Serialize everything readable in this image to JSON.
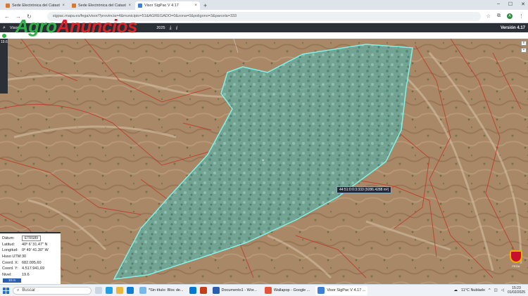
{
  "browser": {
    "tabs": [
      {
        "label": "Sede Electrónica del Catastro",
        "active": false,
        "icon": "catastro-favicon"
      },
      {
        "label": "Sede Electrónica del Catastro",
        "active": false,
        "icon": "catastro-favicon"
      },
      {
        "label": "Visor SigPac V 4.17",
        "active": true,
        "icon": "sigpac-favicon"
      }
    ],
    "newtab": "+",
    "url": "sigpac.mapa.es/fega/visor/?provincia=4&municipio=51&AGREGADO=0&zona=0&poligono=3&parcela=333"
  },
  "watermark": {
    "part1": "Agro",
    "part2": "Anuncios"
  },
  "app": {
    "left_label": "Visor",
    "date_label": "2025",
    "version": "Versión 4.17",
    "scale_label": "19.6"
  },
  "map": {
    "parcel_label": "44:51:0:0:3:333 (9286.4288 m²)"
  },
  "coord_panel": {
    "rows": [
      {
        "key": "Dátum:",
        "value": "ETRS89"
      },
      {
        "key": "Latitud:",
        "value": "40º 6' 31.47\" N"
      },
      {
        "key": "Longitud:",
        "value": "0º 49' 41.30\" W"
      },
      {
        "key": "Huso UTM:",
        "value": "30"
      },
      {
        "key": "Coord. X:",
        "value": "682.095,60"
      },
      {
        "key": "Coord. Y:",
        "value": "4.517.941,69"
      },
      {
        "key": "Nivel:",
        "value": "19.6"
      }
    ],
    "button_label": "10 m"
  },
  "seal": {
    "label": "FEGA"
  },
  "taskbar": {
    "search_placeholder": "Buscar",
    "apps": [
      {
        "label": "*Sin título: Bloc de...",
        "active": false
      },
      {
        "label": "Documento1 - Wor...",
        "active": false
      },
      {
        "label": "Wallapop - Google ...",
        "active": false
      },
      {
        "label": "Visor SigPac V 4.17 ...",
        "active": true
      }
    ],
    "weather": "11°C  Nublado",
    "time": "15:23",
    "date": "01/02/2025"
  },
  "colors": {
    "parcel_fill": "#4fd1c5",
    "parcel_stroke": "#7ff3ea",
    "boundary": "#c0392b",
    "toolbar": "#2b2f36",
    "watermark_green": "#2fb24a",
    "watermark_red": "#d8232a"
  }
}
